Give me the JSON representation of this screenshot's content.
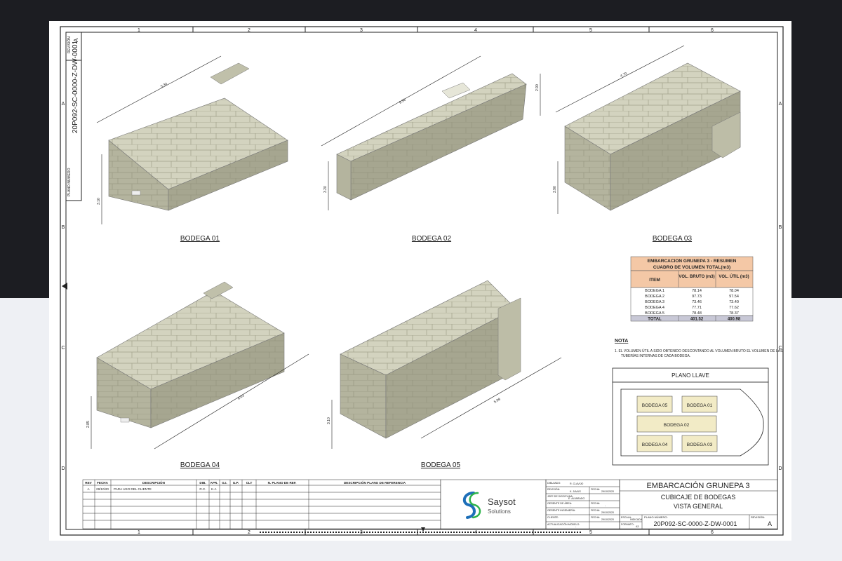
{
  "colors": {
    "background_dark": "#1c1d22",
    "background_light": "#eef0f4",
    "sheet": "#ffffff",
    "ink": "#1a1a1a",
    "hold_fill": "#c9c9b3",
    "hold_side": "#a6a690",
    "hold_top": "#d7d7c3",
    "table_header": "#f4c8a6",
    "plan_box": "#f2ebc6",
    "logo_blue": "#1d6fb8",
    "logo_green": "#2db34a"
  },
  "grid": {
    "columns": [
      "1",
      "2",
      "3",
      "4",
      "5",
      "6"
    ],
    "rows": [
      "A",
      "B",
      "C",
      "D"
    ]
  },
  "side_strip": {
    "revision_label": "REVISIÓN",
    "revision_value": "A",
    "drawing_number": "20P092-SC-0000-Z-DW-0001",
    "plano_label": "PLANO NÚMERO"
  },
  "holds": [
    {
      "label": "BODEGA 01",
      "length": "5.34",
      "height": "3.10"
    },
    {
      "label": "BODEGA 02",
      "length": "9.56",
      "width": "2.90",
      "height": "3.20"
    },
    {
      "label": "BODEGA 03",
      "length": "4.70",
      "height": "3.90"
    },
    {
      "label": "BODEGA 04",
      "length": "6.03",
      "height": "2.85"
    },
    {
      "label": "BODEGA 05",
      "length": "5.99",
      "height": "3.10"
    }
  ],
  "volume_table": {
    "title1": "EMBARCACION GRUNEPA 3 - RESUMEN",
    "title2": "CUADRO DE VOLUMEN TOTAL(m3)",
    "headers": [
      "ITEM",
      "VOL. BRUTO (m3)",
      "VOL. ÚTIL (m3)"
    ],
    "rows": [
      [
        "BODEGA 1",
        "78.14",
        "78.04"
      ],
      [
        "BODEGA 2",
        "97.73",
        "97.54"
      ],
      [
        "BODEGA 3",
        "73.46",
        "73.40"
      ],
      [
        "BODEGA 4",
        "77.71",
        "77.62"
      ],
      [
        "BODEGA 5",
        "78.48",
        "78.37"
      ]
    ],
    "total": [
      "TOTAL",
      "401.52",
      "400.98"
    ]
  },
  "note": {
    "title": "NOTA",
    "text_line1": "1.   EL VOLUMEN ÚTIL A SIDO OBTENIDO DESCONTANDO AL VOLUMEN BRUTO EL VOLUMEN DE LAS",
    "text_line2": "TUBERÍAS INTERNAS DE CADA BODEGA."
  },
  "key_plan": {
    "title": "PLANO LLAVE",
    "boxes": [
      "BODEGA 05",
      "BODEGA 01",
      "BODEGA 02",
      "BODEGA 04",
      "BODEGA 03"
    ]
  },
  "revision_table": {
    "headers": [
      "REV",
      "FECHA",
      "DESCRIPCIÓN",
      "DIB.",
      "APR.",
      "G.I.",
      "G.P.",
      "CLT",
      "N. PLANO DE REF.",
      "DESCRIPCIÓN PLANO DE REFERENCIA"
    ],
    "row1": [
      "A",
      "29/10/20",
      "PARA USO DEL CLIENTE",
      "R.C.",
      "K.J."
    ]
  },
  "logo": {
    "name": "Saysot",
    "subtitle": "Solutions"
  },
  "title_block": {
    "line1": "EMBARCACIÓN GRUNEPA 3",
    "line2": "CUBICAJE DE BODEGAS",
    "line3": "VISTA GENERAL",
    "plano_label": "PLANO NÚMERO:",
    "plano_number": "20P092-SC-0000-Z-DW-0001",
    "rev_label": "REVISIÓN:",
    "rev_value": "A",
    "escala_label": "ESCALA:",
    "escala_value": "INDICADA",
    "formato_label": "FORMATO:",
    "formato_value": "A3"
  },
  "signatures": {
    "dibujado_label": "DIBUJADO:",
    "dibujado_value": "R. CLAVIJO",
    "revisado_label": "REVISIÓN:",
    "revisado_value": "K. JAVUS",
    "jefe_label": "JEFE DE DISCIPLINA:",
    "jefe_value": "E. ALVARADO",
    "gerente_label": "GERENTE DE ÁREA:",
    "gerente_value": "-",
    "ing_label": "GERENTE INGENIERÍA:",
    "ing_value": "-",
    "cliente_label": "CLIENTE:",
    "cliente_value": "-",
    "act_label": "ACTUALIZACIÓN MODELO:",
    "act_value": "-",
    "fecha_label": "FECHA:",
    "fecha1": "29/10/2020",
    "fecha2": "-",
    "fecha3": "29/10/2020",
    "fecha4": "29/10/2020"
  }
}
